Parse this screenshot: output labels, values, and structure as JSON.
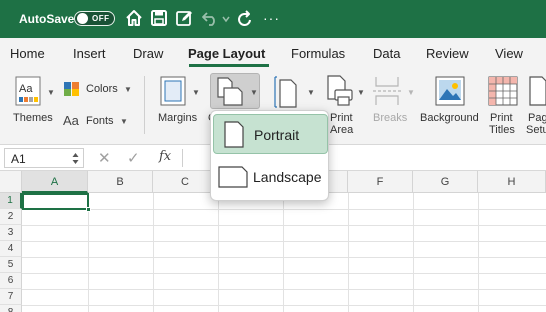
{
  "titlebar": {
    "autosave_label": "AutoSave",
    "toggle_state": "OFF",
    "icons": [
      "home-icon",
      "save-icon",
      "edit-icon",
      "undo-icon",
      "redo-icon"
    ]
  },
  "tabs": [
    {
      "label": "Home"
    },
    {
      "label": "Insert"
    },
    {
      "label": "Draw"
    },
    {
      "label": "Page Layout",
      "active": true
    },
    {
      "label": "Formulas"
    },
    {
      "label": "Data"
    },
    {
      "label": "Review"
    },
    {
      "label": "View"
    }
  ],
  "ribbon": {
    "themes": "Themes",
    "colors": "Colors",
    "fonts": "Fonts",
    "margins": "Margins",
    "orientation_short": "O",
    "print_area_line1": "Print",
    "print_area_line2": "Area",
    "breaks": "Breaks",
    "background": "Background",
    "print_titles_line1": "Print",
    "print_titles_line2": "Titles",
    "page_setup_line1": "Pag",
    "page_setup_line2": "Setu"
  },
  "formula_bar": {
    "name_box": "A1",
    "fx": "fx"
  },
  "grid": {
    "columns": [
      "A",
      "B",
      "C",
      "D",
      "E",
      "F",
      "G",
      "H"
    ],
    "rows": [
      "1",
      "2",
      "3",
      "4",
      "5",
      "6",
      "7",
      "8"
    ],
    "selected_cell": "A1"
  },
  "orientation_menu": {
    "items": [
      {
        "label": "Portrait",
        "highlighted": true
      },
      {
        "label": "Landscape"
      }
    ]
  },
  "colors": {
    "accent": "#1e7145",
    "highlight": "#c6e2d1"
  }
}
